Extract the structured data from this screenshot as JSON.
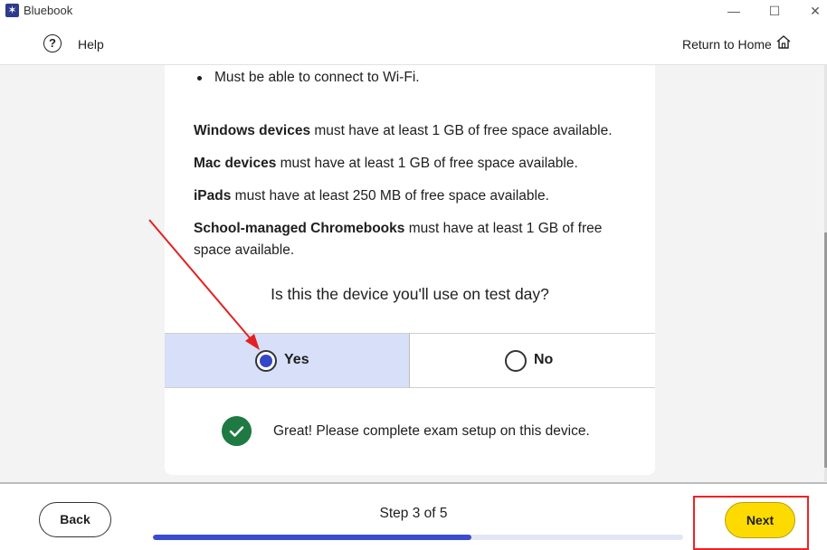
{
  "window": {
    "app_title": "Bluebook",
    "controls": {
      "minimize": "—",
      "maximize": "☐",
      "close": "✕"
    }
  },
  "header": {
    "help_label": "Help",
    "home_label": "Return to Home"
  },
  "content": {
    "bullet": "Must be able to connect to Wi-Fi.",
    "requirements": [
      {
        "device": "Windows devices",
        "text": " must have at least 1 GB of free space available."
      },
      {
        "device": "Mac devices",
        "text": " must have at least 1 GB of free space available."
      },
      {
        "device": "iPads",
        "text": " must have at least 250 MB of free space available."
      },
      {
        "device": "School-managed Chromebooks",
        "text": " must have at least 1 GB of free space available."
      }
    ],
    "question": "Is this the device you'll use on test day?",
    "options": [
      {
        "label": "Yes",
        "selected": true
      },
      {
        "label": "No",
        "selected": false
      }
    ],
    "confirmation": "Great! Please complete exam setup on this device."
  },
  "footer": {
    "back_label": "Back",
    "step_label": "Step 3 of 5",
    "progress": 0.6,
    "next_label": "Next"
  },
  "colors": {
    "accent": "#3c4ccf",
    "selected_bg": "#d8dff8",
    "next_button": "#fedb00",
    "success": "#1e7a42",
    "annotation": "#e22222"
  },
  "icons": {
    "help": "question-circle-icon",
    "home": "home-icon",
    "check": "check-circle-icon",
    "app": "bluebook-logo-icon"
  }
}
